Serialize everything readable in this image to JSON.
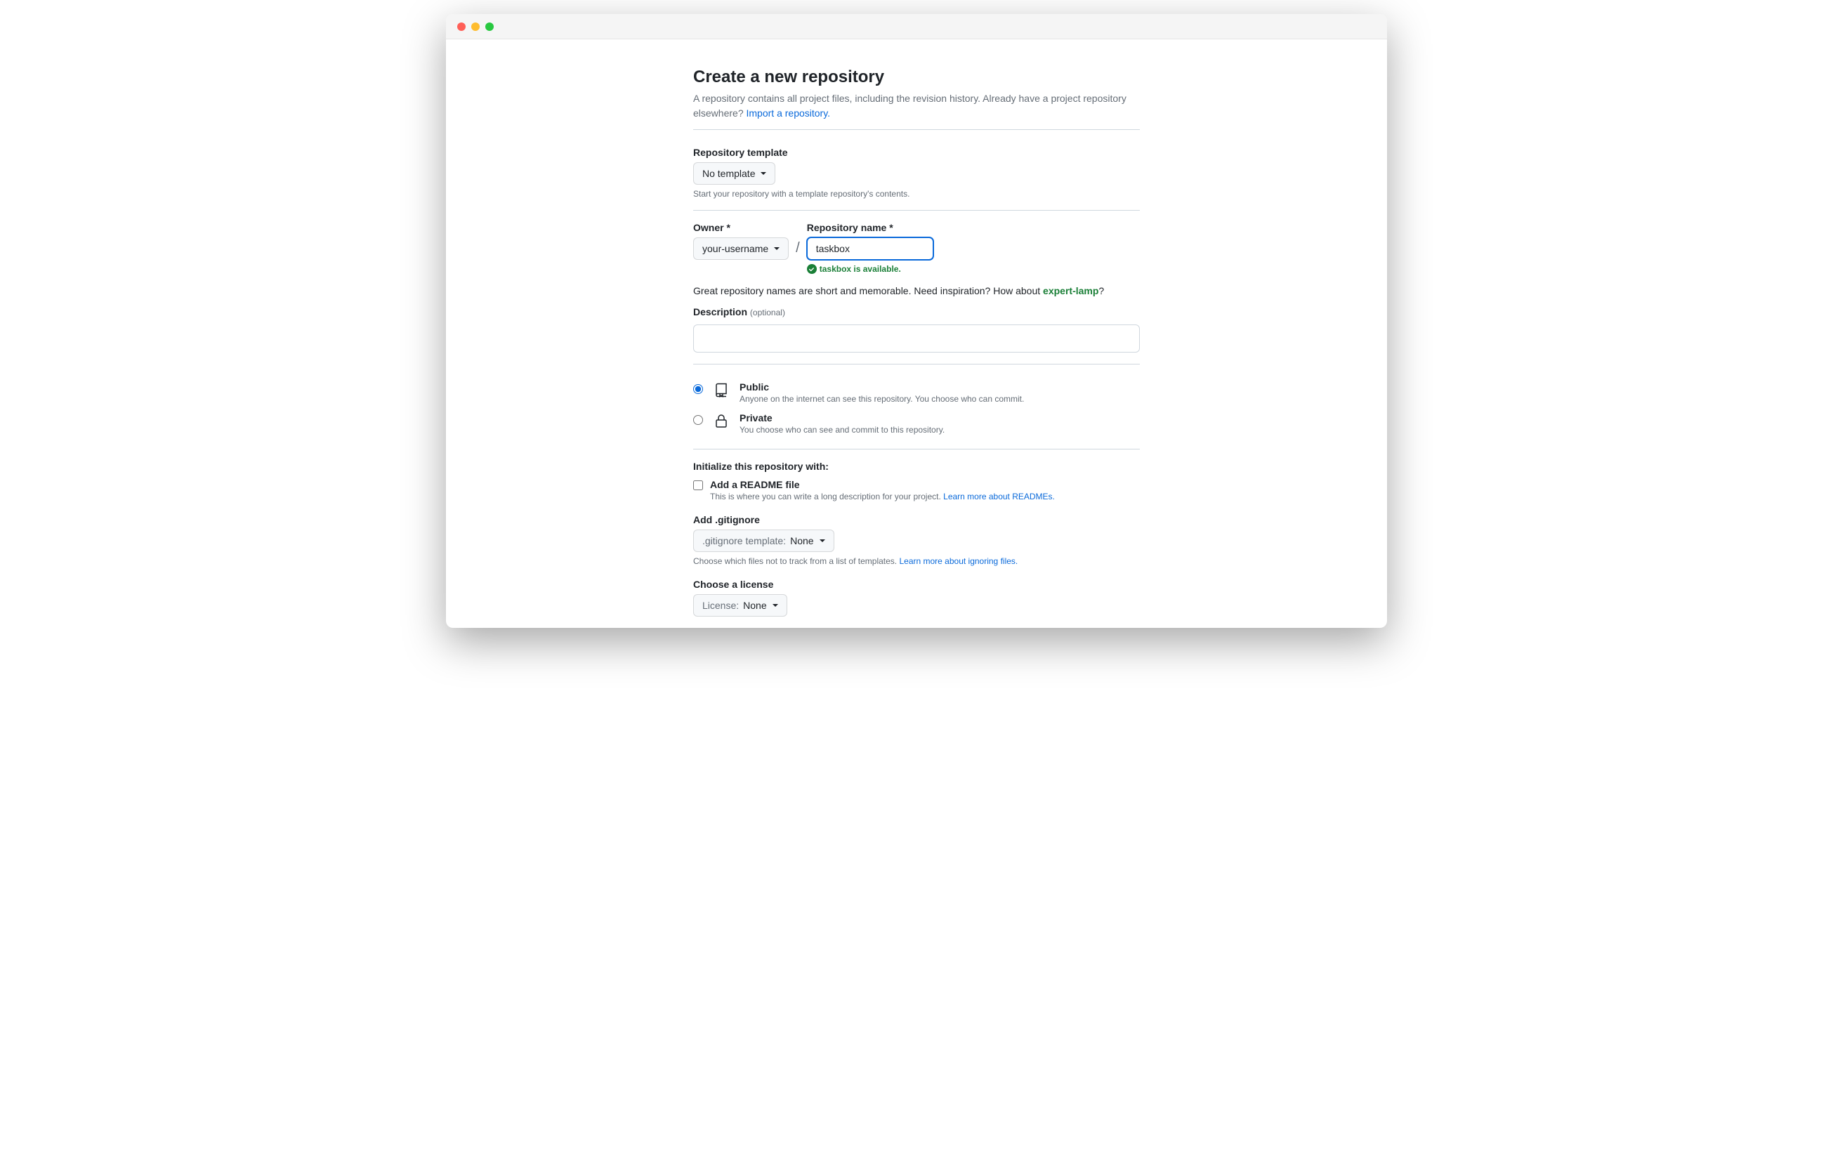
{
  "page": {
    "title": "Create a new repository",
    "subtitle_pre": "A repository contains all project files, including the revision history. Already have a project repository elsewhere? ",
    "import_link": "Import a repository."
  },
  "template": {
    "label": "Repository template",
    "value": "No template",
    "helper": "Start your repository with a template repository's contents."
  },
  "owner": {
    "label": "Owner *",
    "value": "your-username",
    "slash": "/"
  },
  "repo": {
    "label": "Repository name *",
    "value": "taskbox",
    "available_text": "taskbox is available."
  },
  "name_tip": {
    "pre": "Great repository names are short and memorable. Need inspiration? How about ",
    "suggest": "expert-lamp",
    "post": "?"
  },
  "description": {
    "label": "Description",
    "optional": "(optional)"
  },
  "visibility": {
    "public": {
      "title": "Public",
      "desc": "Anyone on the internet can see this repository. You choose who can commit."
    },
    "private": {
      "title": "Private",
      "desc": "You choose who can see and commit to this repository."
    }
  },
  "initialize": {
    "title": "Initialize this repository with:",
    "readme": {
      "title": "Add a README file",
      "helper_pre": "This is where you can write a long description for your project. ",
      "helper_link": "Learn more about READMEs."
    },
    "gitignore": {
      "label": "Add .gitignore",
      "prefix": ".gitignore template: ",
      "value": "None",
      "helper_pre": "Choose which files not to track from a list of templates. ",
      "helper_link": "Learn more about ignoring files."
    },
    "license": {
      "label": "Choose a license",
      "prefix": "License: ",
      "value": "None"
    }
  }
}
